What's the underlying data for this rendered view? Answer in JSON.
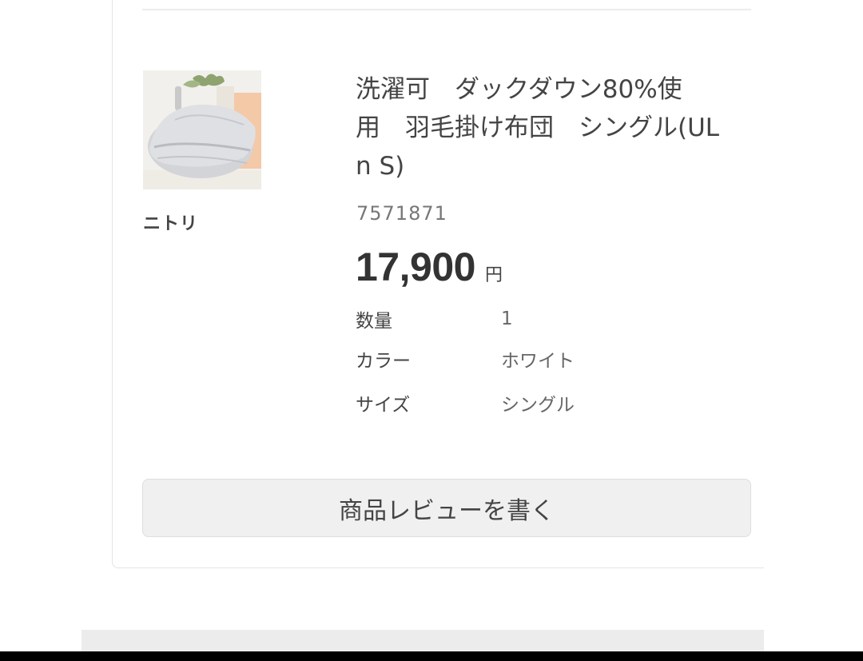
{
  "product": {
    "image_icon": "futon-product-image",
    "brand": "ニトリ",
    "title": "洗濯可　ダックダウン80%使\n用　羽毛掛け布団　シングル(UL\nn S)",
    "sku": "7571871",
    "price": "17,900",
    "currency": "円"
  },
  "specs": [
    {
      "label": "数量",
      "value": "1"
    },
    {
      "label": "カラー",
      "value": "ホワイト"
    },
    {
      "label": "サイズ",
      "value": "シングル"
    }
  ],
  "review_button": {
    "label": "商品レビューを書く"
  }
}
